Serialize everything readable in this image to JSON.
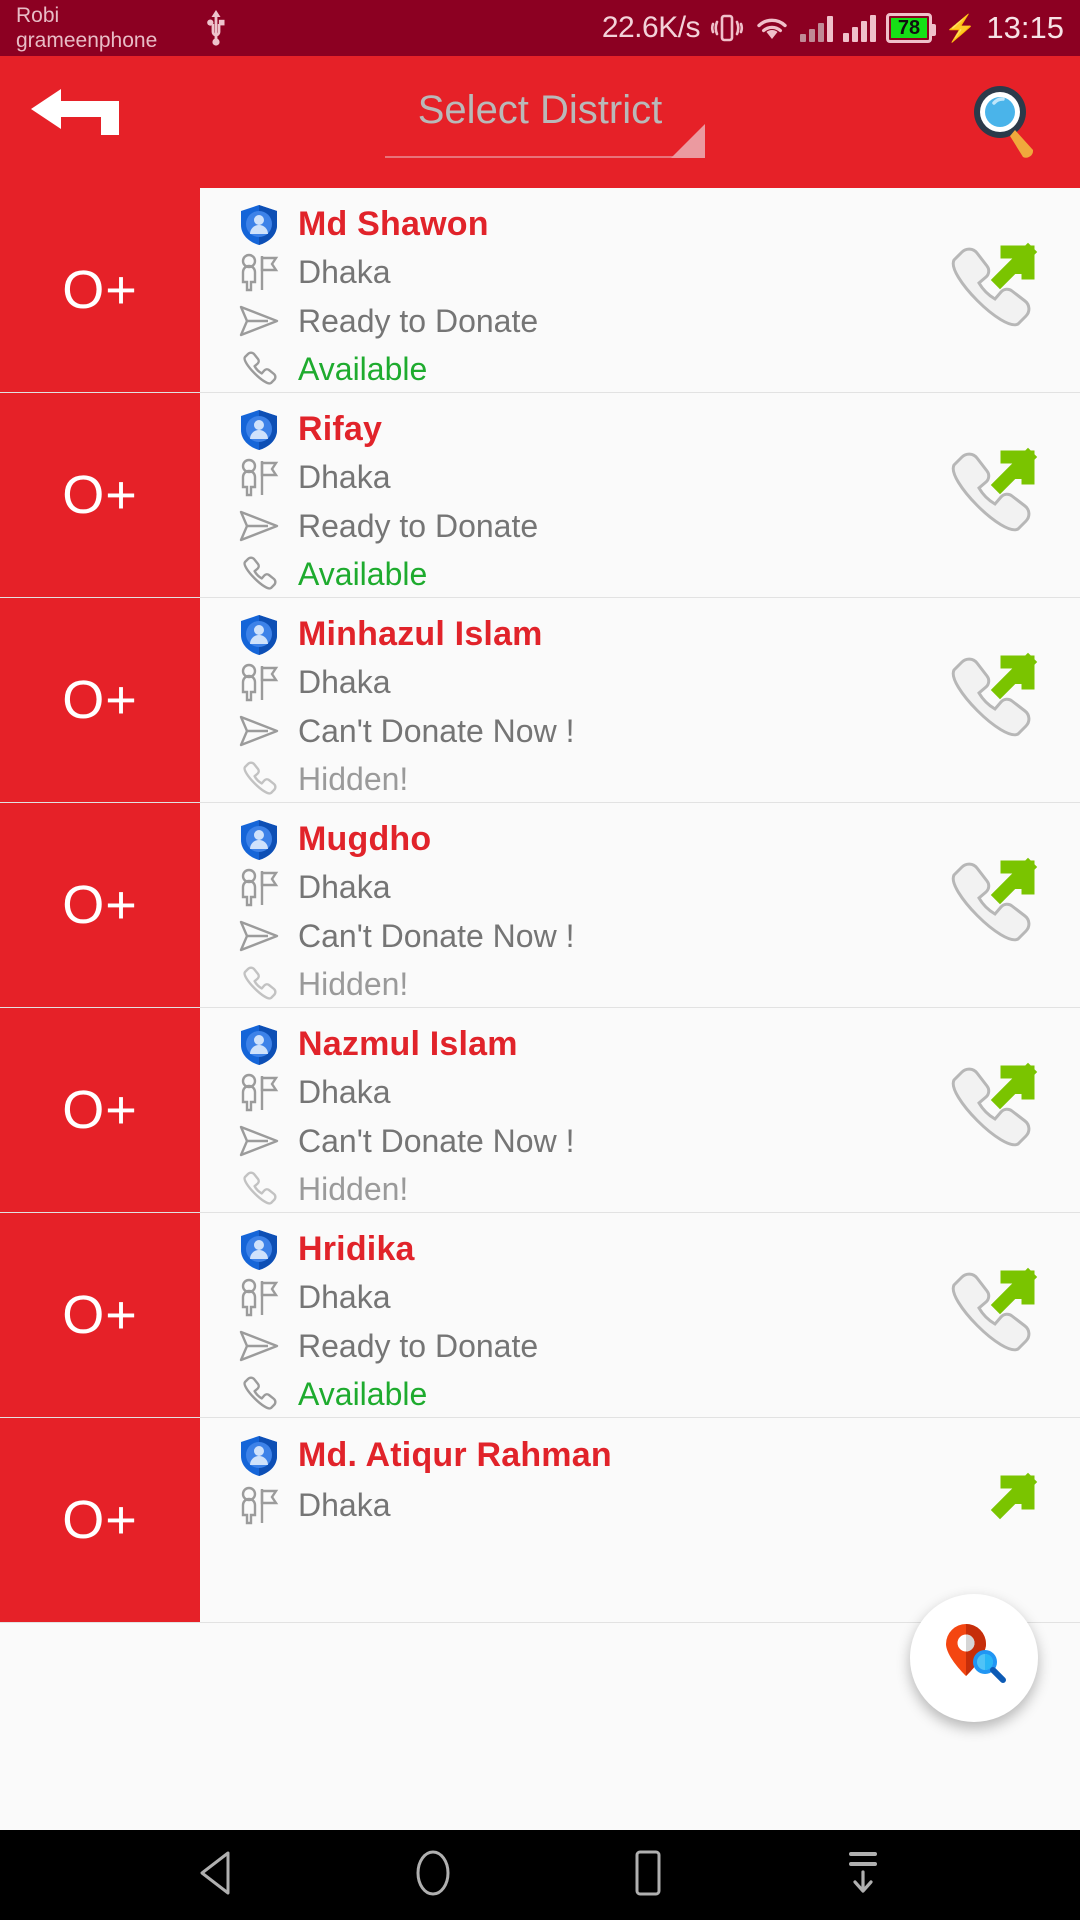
{
  "statusbar": {
    "carrier_line1": "Robi",
    "carrier_line2": "grameenphone",
    "usb_icon": "usb-icon",
    "network_speed": "22.6K/s",
    "vibrate_icon": "vibrate-icon",
    "wifi_icon": "wifi-icon",
    "signal_icon_1": "signal-bars-icon",
    "signal_icon_2": "signal-bars-icon",
    "battery_level": "78",
    "charging_icon": "charging-bolt-icon",
    "clock": "13:15"
  },
  "appbar": {
    "back_icon": "back-arrow-icon",
    "spinner_value": "Select District",
    "spinner_caret_icon": "dropdown-triangle-icon",
    "search_icon": "search-icon",
    "background_color": "#E62128"
  },
  "icons": {
    "verified": "shield-person-icon",
    "district": "person-flag-icon",
    "status": "paper-plane-icon",
    "phone": "phone-handset-icon",
    "call": "outgoing-call-icon"
  },
  "colors": {
    "brand_red": "#E62128",
    "name_red": "#E1232A",
    "available_green": "#1eab2e",
    "hidden_grey": "#9a9a9a",
    "statusbar": "#8C0022"
  },
  "donors": [
    {
      "blood_group": "O+",
      "name": "Md Shawon",
      "district": "Dhaka",
      "donate_status": "Ready to Donate",
      "availability": "Available",
      "availability_state": "ok"
    },
    {
      "blood_group": "O+",
      "name": "Rifay",
      "district": "Dhaka",
      "donate_status": "Ready to Donate",
      "availability": "Available",
      "availability_state": "ok"
    },
    {
      "blood_group": "O+",
      "name": "Minhazul Islam",
      "district": "Dhaka",
      "donate_status": "Can't Donate Now !",
      "availability": "Hidden!",
      "availability_state": "hid"
    },
    {
      "blood_group": "O+",
      "name": "Mugdho",
      "district": "Dhaka",
      "donate_status": "Can't Donate Now !",
      "availability": "Hidden!",
      "availability_state": "hid"
    },
    {
      "blood_group": "O+",
      "name": "Nazmul Islam",
      "district": "Dhaka",
      "donate_status": "Can't Donate Now !",
      "availability": "Hidden!",
      "availability_state": "hid"
    },
    {
      "blood_group": "O+",
      "name": "Hridika",
      "district": "Dhaka",
      "donate_status": "Ready to Donate",
      "availability": "Available",
      "availability_state": "ok"
    },
    {
      "blood_group": "O+",
      "name": "Md. Atiqur Rahman",
      "district": "Dhaka",
      "donate_status": "",
      "availability": "",
      "availability_state": "ok"
    }
  ],
  "fab": {
    "icon": "map-pin-search-icon"
  },
  "navbar": {
    "back": "nav-back-icon",
    "home": "nav-home-icon",
    "recents": "nav-recents-icon",
    "hide_keyboard": "nav-hide-keyboard-icon"
  }
}
